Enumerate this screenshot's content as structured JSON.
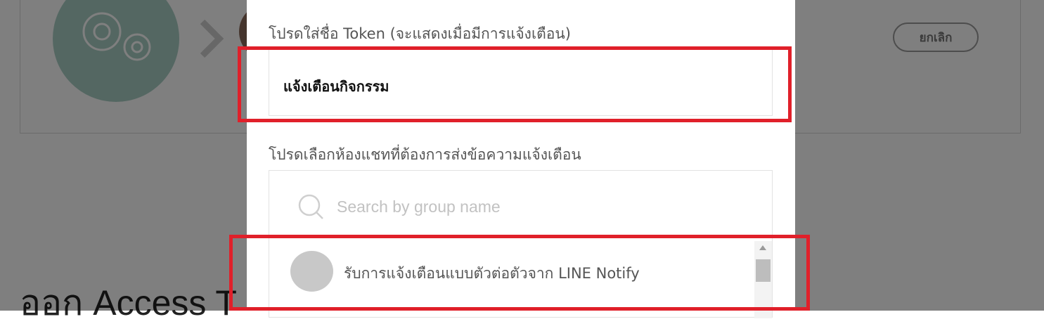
{
  "background": {
    "cancel_label": "ยกเลิก",
    "heading_partial": "ออก Access T"
  },
  "modal": {
    "token_label": "โปรดใส่ชื่อ Token (จะแสดงเมื่อมีการแจ้งเตือน)",
    "token_value": "แจ้งเตือนกิจกรรม",
    "room_label": "โปรดเลือกห้องแชทที่ต้องการส่งข้อความแจ้งเตือน",
    "search_placeholder": "Search by group name",
    "room_items": [
      {
        "label": "รับการแจ้งเตือนแบบตัวต่อตัวจาก LINE Notify"
      }
    ]
  },
  "colors": {
    "highlight": "#e0202a",
    "gear_circle": "#a9cfc5",
    "overlay": "rgba(0,0,0,0.5)"
  }
}
